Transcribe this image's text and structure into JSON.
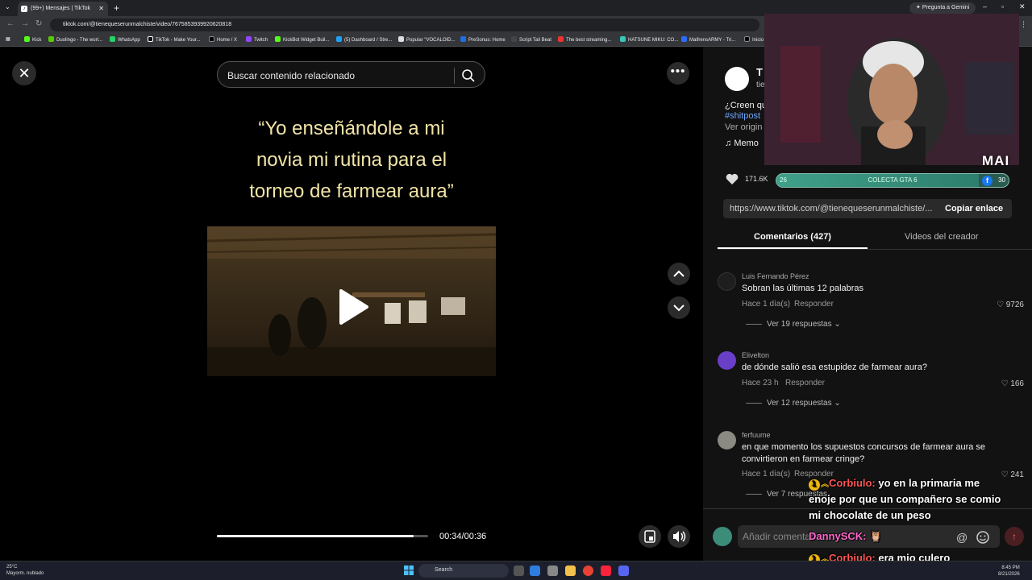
{
  "browser": {
    "tab_title": "(99+) Mensajes | TikTok",
    "gemini_label": "Pregunta a Gemini",
    "url": "tiktok.com/@tienequeserunmalchiste/video/7675853939920620818",
    "bookmarks": [
      "Kick",
      "Duolingo - The worl...",
      "WhatsApp",
      "TikTok - Make Your...",
      "Home / X",
      "Twitch",
      "KickBot Widget Buil...",
      "(5) Dashboard / Stre...",
      "Popular \"VOCALOID...",
      "PreSonus: Home",
      "Script Tail Beat",
      "The best streaming...",
      "HATSUNE MIKU: CO...",
      "MaifrensARMY - Tri...",
      "Inicio"
    ]
  },
  "video": {
    "search_placeholder": "Buscar contenido relacionado",
    "caption_lines": [
      "“Yo enseñándole a mi",
      "novia mi rutina para el",
      "torneo de farmear aura”"
    ],
    "time": "00:34/00:36",
    "progress": 0.93
  },
  "panel": {
    "author_name": "T",
    "author_handle": "tie",
    "desc_line1": "¿Creen qu",
    "desc_line2": "#shitpost",
    "desc_line3": "Ver origin",
    "music": "Memo",
    "likes": "171.6K",
    "link_url": "https://www.tiktok.com/@tienequeserunmalchiste/...",
    "copy_label": "Copiar enlace",
    "tab_comments": "Comentarios (427)",
    "tab_creator": "Videos del creador",
    "comments": [
      {
        "user": "Luis Fernando Pérez",
        "text": "Sobran las últimas 12 palabras",
        "time": "Hace 1 día(s)",
        "reply": "Responder",
        "likes": "9726",
        "more": "Ver 19 respuestas"
      },
      {
        "user": "Elivelton",
        "text": "de dónde salió esa estupidez de farmear aura?",
        "time": "Hace 23 h",
        "reply": "Responder",
        "likes": "166",
        "more": "Ver 12 respuestas"
      },
      {
        "user": "ferfuume",
        "text": "en que momento los supuestos concursos de farmear aura se convirtieron en farmear cringe?",
        "time": "Hace 1 día(s)",
        "reply": "Responder",
        "likes": "241",
        "more": "Ver 7 respuestas"
      }
    ],
    "comment_placeholder": "Añadir comentario..."
  },
  "overlay": {
    "logo": "MAI",
    "goal_label": "COLECTA GTA 6",
    "goal_left": "26",
    "goal_right": "30",
    "goal_progress": 0.87,
    "chat": [
      {
        "badge": "1",
        "name": "Corbiulo:",
        "text": "yo en la primaria me"
      },
      {
        "text": "enoje por que un compañero se comio"
      },
      {
        "text": "mi chocolate de un peso"
      },
      {
        "name": "DannySCK:",
        "text": "🦉"
      },
      {
        "badge": "1",
        "name": "Corbiulo:",
        "text": "era mio culero"
      }
    ]
  },
  "taskbar": {
    "temp": "25°C",
    "weather": "Mayorm. nublado",
    "search": "Search",
    "time": "8:45 PM",
    "date": "8/21/2026"
  }
}
